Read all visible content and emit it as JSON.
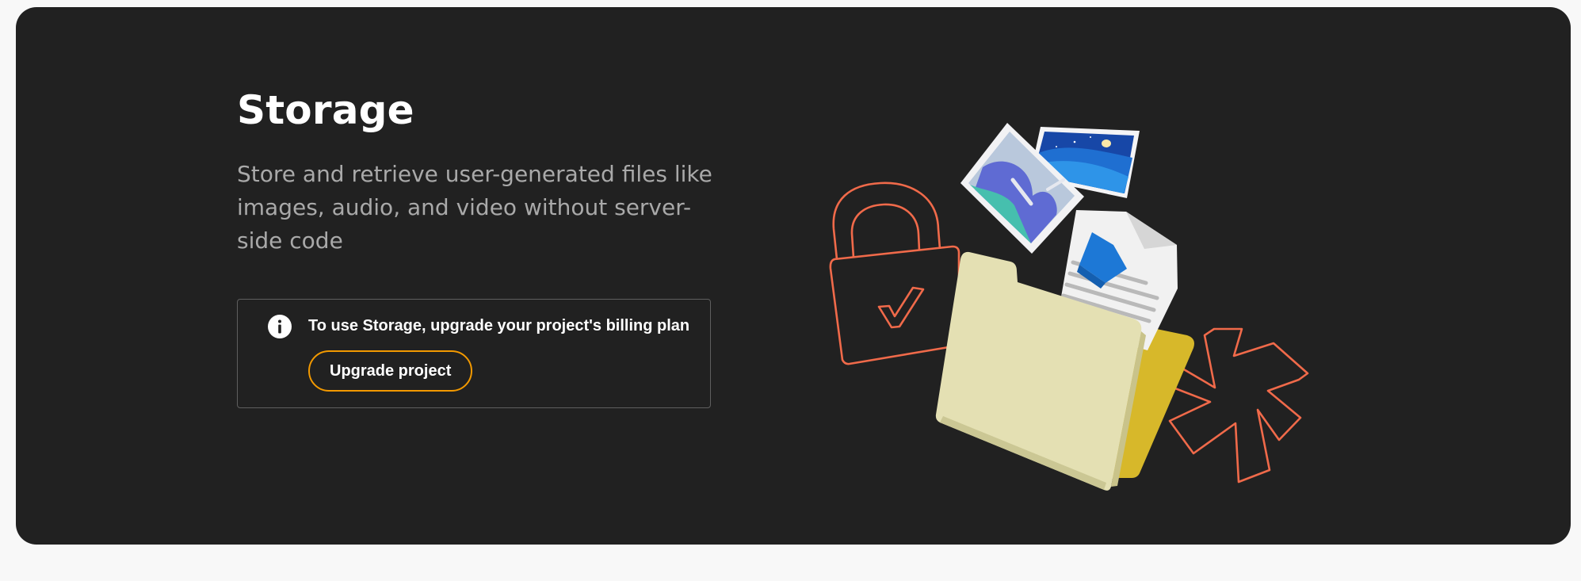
{
  "hero": {
    "title": "Storage",
    "description": "Store and retrieve user-generated files like images, audio, and video without server-side code",
    "notice": {
      "icon": "info-icon",
      "text": "To use Storage, upgrade your project's billing plan",
      "button_label": "Upgrade project"
    },
    "illustration": {
      "elements": [
        "lock-icon",
        "photo-icon",
        "night-photo-icon",
        "document-icon",
        "folder-icon",
        "asterisk-icon"
      ]
    }
  },
  "colors": {
    "page_background": "#f8f8f8",
    "card_background": "#212121",
    "title": "#ffffff",
    "description": "#a9a9a9",
    "button_border": "#f29900",
    "illustration_stroke": "#f06a4a",
    "folder_front": "#e4e0b3",
    "folder_back": "#d7b82a"
  }
}
